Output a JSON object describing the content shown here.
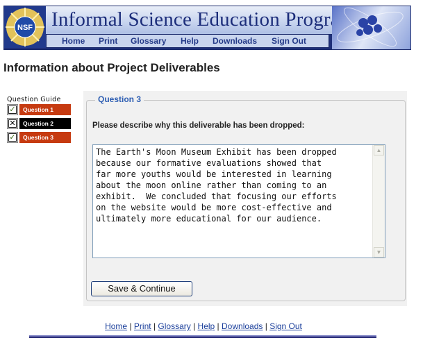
{
  "banner": {
    "logo_text": "NSF",
    "title": "Informal Science Education Program",
    "nav": [
      "Home",
      "Print",
      "Glossary",
      "Help",
      "Downloads",
      "Sign Out"
    ]
  },
  "page_title": "Information about Project Deliverables",
  "guide": {
    "label": "Question Guide",
    "items": [
      {
        "label": "Question 1",
        "state": "checked",
        "color": "#c63a10"
      },
      {
        "label": "Question 2",
        "state": "crossed",
        "color": "#000000"
      },
      {
        "label": "Question 3",
        "state": "checked",
        "color": "#c63a10"
      }
    ]
  },
  "form": {
    "legend": "Question 3",
    "prompt": "Please describe why this deliverable has been dropped:",
    "answer": "The Earth's Moon Museum Exhibit has been dropped\nbecause our formative evaluations showed that\nfar more youths would be interested in learning\nabout the moon online rather than coming to an\nexhibit.  We concluded that focusing our efforts\non the website would be more cost-effective and\nultimately more educational for our audience.",
    "save_label": "Save & Continue"
  },
  "footer": {
    "links": [
      "Home",
      "Print",
      "Glossary",
      "Help",
      "Downloads",
      "Sign Out"
    ],
    "separator": " | "
  },
  "colors": {
    "accent_blue": "#2f5fb3",
    "tab_red": "#c63a10",
    "banner_navy": "#1c2d7a"
  }
}
